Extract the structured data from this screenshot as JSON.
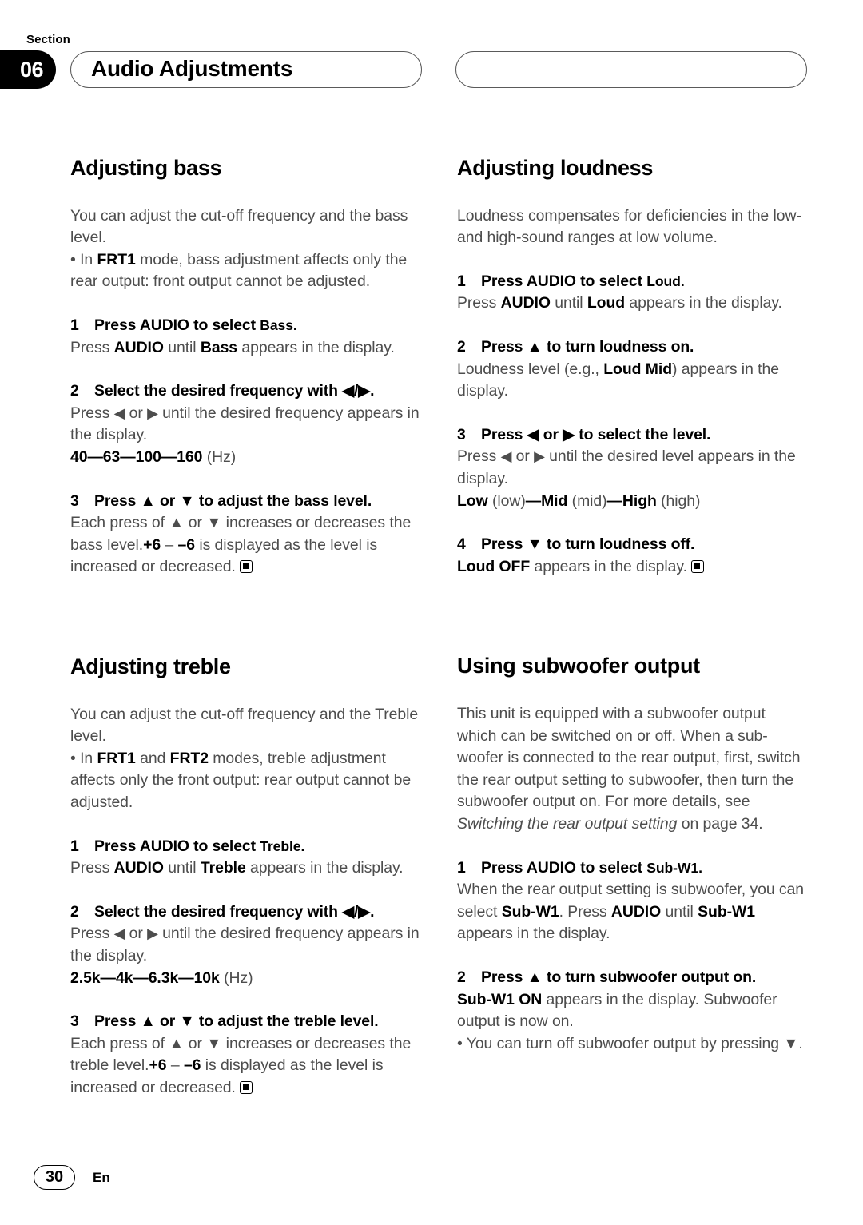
{
  "header": {
    "section_label": "Section",
    "section_number": "06",
    "title": "Audio Adjustments",
    "right_box_text": ""
  },
  "footer": {
    "page_number": "30",
    "language": "En"
  },
  "left_column": {
    "bass": {
      "heading": "Adjusting bass",
      "intro": "You can adjust the cut-off frequency and the bass level.",
      "bullet_prefix": "• In ",
      "bullet_bold": "FRT1",
      "bullet_rest": " mode, bass adjustment affects only the rear output: front output cannot be adjusted.",
      "step1": {
        "num": "1",
        "head_a": "Press AUDIO to select ",
        "head_b": "Bass.",
        "body_a": "Press ",
        "body_b": "AUDIO",
        "body_c": " until ",
        "body_d": "Bass",
        "body_e": " appears in the display."
      },
      "step2": {
        "num": "2",
        "head": "Select the desired frequency with ◀/▶.",
        "body_a": "Press ",
        "body_b": "◀",
        "body_c": " or ",
        "body_d": "▶",
        "body_e": " until the desired frequency appears in the display.",
        "values_bold": "40—63—100—160",
        "values_unit": " (Hz)"
      },
      "step3": {
        "num": "3",
        "head": "Press ▲ or ▼ to adjust the bass level.",
        "body_a": "Each press of ▲ or ▼ increases or decreases the bass level.",
        "body_b": "+6",
        "body_c": " – ",
        "body_d": "–6",
        "body_e": " is displayed as the level is increased or decreased."
      }
    },
    "treble": {
      "heading": "Adjusting treble",
      "intro": "You can adjust the cut-off frequency and the Treble level.",
      "bullet_prefix": "• In ",
      "bullet_bold1": "FRT1",
      "bullet_mid": " and ",
      "bullet_bold2": "FRT2",
      "bullet_rest": " modes, treble adjustment affects only the front output: rear output cannot be adjusted.",
      "step1": {
        "num": "1",
        "head_a": "Press AUDIO to select ",
        "head_b": "Treble.",
        "body_a": "Press ",
        "body_b": "AUDIO",
        "body_c": " until ",
        "body_d": "Treble",
        "body_e": " appears in the display."
      },
      "step2": {
        "num": "2",
        "head": "Select the desired frequency with ◀/▶.",
        "body_a": "Press ",
        "body_b": "◀",
        "body_c": " or ",
        "body_d": "▶",
        "body_e": " until the desired frequency appears in the display.",
        "values_bold": "2.5k—4k—6.3k—10k",
        "values_unit": " (Hz)"
      },
      "step3": {
        "num": "3",
        "head": "Press ▲ or ▼ to adjust the treble level.",
        "body_a": "Each press of ▲ or ▼ increases or decreases the treble level.",
        "body_b": "+6",
        "body_c": " – ",
        "body_d": "–6",
        "body_e": " is displayed as the level is increased or decreased."
      }
    }
  },
  "right_column": {
    "loudness": {
      "heading": "Adjusting loudness",
      "intro": "Loudness compensates for deficiencies in the low- and high-sound ranges at low volume.",
      "step1": {
        "num": "1",
        "head_a": "Press AUDIO to select ",
        "head_b": "Loud.",
        "body_a": "Press ",
        "body_b": "AUDIO",
        "body_c": " until ",
        "body_d": "Loud",
        "body_e": " appears in the display."
      },
      "step2": {
        "num": "2",
        "head": "Press ▲ to turn loudness on.",
        "body_a": "Loudness level (e.g., ",
        "body_b": "Loud Mid",
        "body_c": ") appears in the display."
      },
      "step3": {
        "num": "3",
        "head": "Press ◀ or ▶ to select the level.",
        "body_a": "Press ",
        "body_b": "◀",
        "body_c": " or ",
        "body_d": "▶",
        "body_e": " until the desired level appears in the display.",
        "values": [
          {
            "bold": "Low",
            "plain": " (low)"
          },
          {
            "bold": "Mid",
            "plain": " (mid)"
          },
          {
            "bold": "High",
            "plain": " (high)"
          }
        ],
        "separator": "—"
      },
      "step4": {
        "num": "4",
        "head": "Press ▼ to turn loudness off.",
        "body_a": "Loud OFF",
        "body_b": " appears in the display."
      }
    },
    "subwoofer": {
      "heading": "Using subwoofer output",
      "intro_a": "This unit is equipped with a subwoofer output which can be switched on or off. When a sub-woofer is connected to the rear output, first, switch the rear output setting to subwoofer, then turn the subwoofer output on. For more details, see ",
      "intro_italic": "Switching the rear output setting",
      "intro_b": " on page 34.",
      "step1": {
        "num": "1",
        "head_a": "Press AUDIO to select ",
        "head_b": "Sub-W1.",
        "body_a": "When the rear output setting is subwoofer, you can select ",
        "body_b": "Sub-W1",
        "body_c": ". Press ",
        "body_d": "AUDIO",
        "body_e": " until ",
        "body_f": "Sub-W1",
        "body_g": " appears in the display."
      },
      "step2": {
        "num": "2",
        "head": "Press ▲ to turn subwoofer output on.",
        "body_a": "Sub-W1 ON",
        "body_b": " appears in the display. Subwoofer output is now on.",
        "bullet": "• You can turn off subwoofer output by pressing ▼."
      }
    }
  }
}
